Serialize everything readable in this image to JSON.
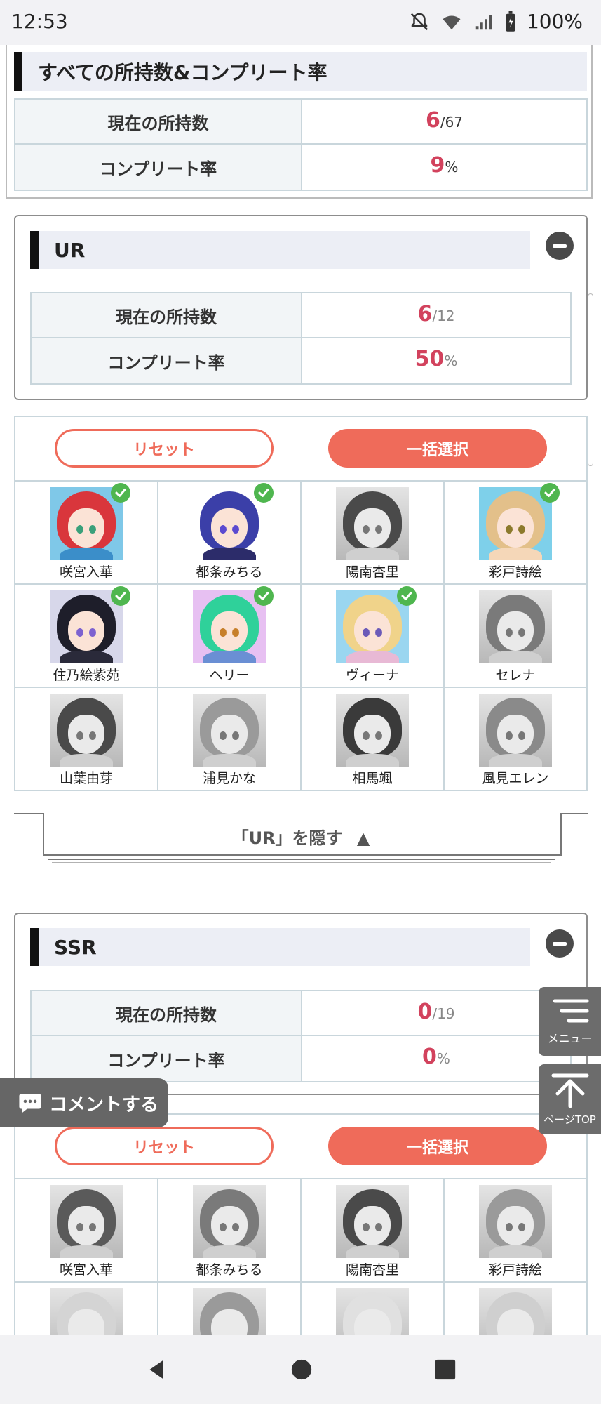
{
  "status_bar": {
    "time": "12:53",
    "battery": "100%",
    "icons": [
      "mute-icon",
      "wifi-icon",
      "signal-icon",
      "battery-icon"
    ]
  },
  "summary": {
    "title": "すべての所持数&コンプリート率",
    "rows": [
      {
        "label": "現在の所持数",
        "value": "6",
        "suffix": "/67"
      },
      {
        "label": "コンプリート率",
        "value": "9",
        "suffix": "%"
      }
    ]
  },
  "ur": {
    "title": "UR",
    "rows": [
      {
        "label": "現在の所持数",
        "value": "6",
        "suffix": "/12"
      },
      {
        "label": "コンプリート率",
        "value": "50",
        "suffix": "%"
      }
    ],
    "reset_label": "リセット",
    "select_all_label": "一括選択",
    "characters": [
      {
        "name": "咲宮入華",
        "owned": true
      },
      {
        "name": "都条みちる",
        "owned": true
      },
      {
        "name": "陽南杏里",
        "owned": false
      },
      {
        "name": "彩戸詩絵",
        "owned": true
      },
      {
        "name": "住乃絵紫苑",
        "owned": true
      },
      {
        "name": "ヘリー",
        "owned": true
      },
      {
        "name": "ヴィーナ",
        "owned": true
      },
      {
        "name": "セレナ",
        "owned": false
      },
      {
        "name": "山葉由芽",
        "owned": false
      },
      {
        "name": "浦見かな",
        "owned": false
      },
      {
        "name": "相馬颯",
        "owned": false
      },
      {
        "name": "風見エレン",
        "owned": false
      }
    ],
    "hide_label": "「UR」を隠す"
  },
  "ssr": {
    "title": "SSR",
    "rows": [
      {
        "label": "現在の所持数",
        "value": "0",
        "suffix": "/19"
      },
      {
        "label": "コンプリート率",
        "value": "0",
        "suffix": "%"
      }
    ],
    "reset_label": "リセット",
    "select_all_label": "一括選択",
    "characters": [
      {
        "name": "咲宮入華",
        "owned": false
      },
      {
        "name": "都条みちる",
        "owned": false
      },
      {
        "name": "陽南杏里",
        "owned": false
      },
      {
        "name": "彩戸詩絵",
        "owned": false
      }
    ]
  },
  "floating": {
    "comment_label": "コメントする",
    "menu_label": "メニュー",
    "page_top_label": "ページTOP"
  },
  "nav": [
    "back-icon",
    "home-icon",
    "recents-icon"
  ]
}
